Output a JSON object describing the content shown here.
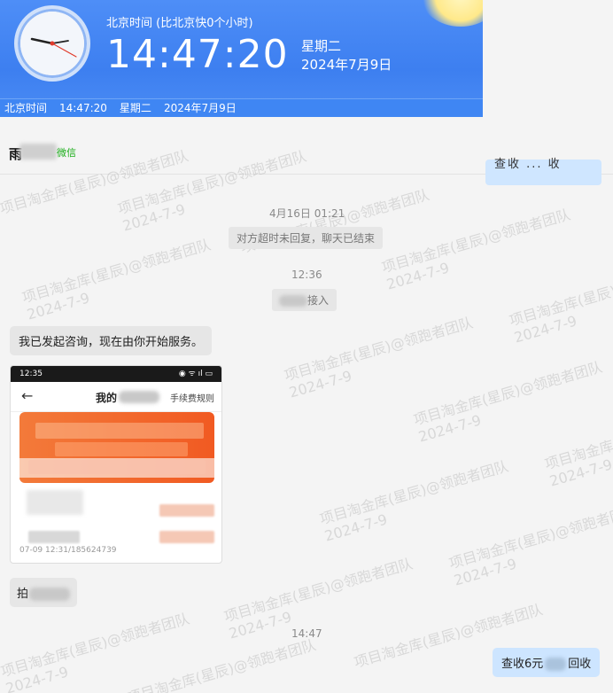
{
  "clock": {
    "label": "北京时间 (比北京快0个小时)",
    "time": "14:47:20",
    "weekday": "星期二",
    "date": "2024年7月9日",
    "status_label": "北京时间",
    "status_time": "14:47:20",
    "status_weekday": "星期二",
    "status_date": "2024年7月9日"
  },
  "chat": {
    "contact_initial": "雨",
    "source": "微信",
    "watermark_line1": "项目淘金库(星辰)@领跑者团队",
    "watermark_line2": "2024-7-9"
  },
  "messages": {
    "time1": "4月16日 01:21",
    "notice1": "对方超时未回复，聊天已结束",
    "time2": "12:36",
    "notice2": "接入",
    "msg1": "我已发起咨询，现在由你开始服务。",
    "msg2_initial": "拍",
    "time3": "14:47",
    "out1_prefix": "查收6元",
    "out1_suffix": "回收"
  },
  "phone": {
    "time": "12:35",
    "title": "我的",
    "title_right": "手续费规则",
    "row_text": "07-09 12:31/185624739"
  }
}
